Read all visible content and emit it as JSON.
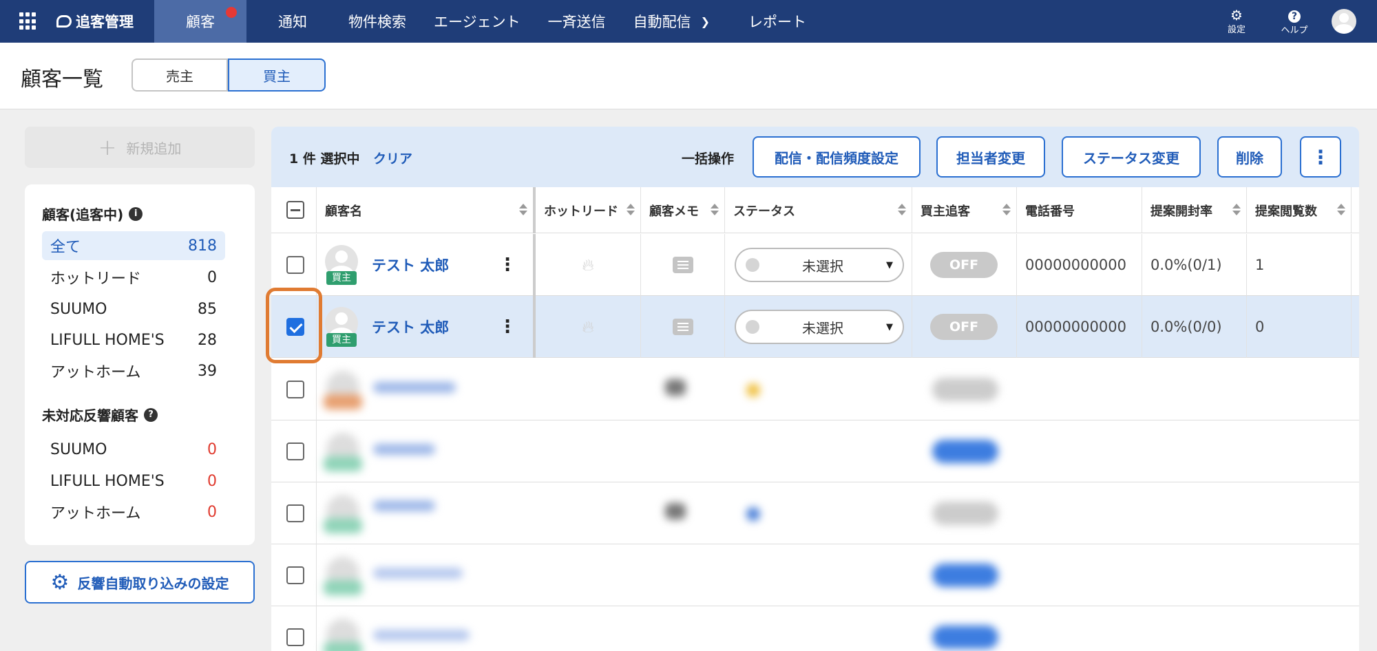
{
  "nav": {
    "brand": "追客管理",
    "items": [
      {
        "label": "顧客",
        "active": true,
        "notify": true
      },
      {
        "label": "通知"
      },
      {
        "label": "物件検索"
      },
      {
        "label": "エージェント"
      },
      {
        "label": "一斉送信"
      },
      {
        "label": "自動配信",
        "dropdown": true
      },
      {
        "label": "レポート"
      }
    ],
    "settings_label": "設定",
    "help_label": "ヘルプ"
  },
  "page": {
    "title": "顧客一覧",
    "tabs": [
      {
        "label": "売主"
      },
      {
        "label": "買主",
        "active": true
      }
    ]
  },
  "sidebar": {
    "new_button": "新規追加",
    "section1_title": "顧客(追客中)",
    "section1_items": [
      {
        "label": "全て",
        "count": "818",
        "selected": true
      },
      {
        "label": "ホットリード",
        "count": "0"
      },
      {
        "label": "SUUMO",
        "count": "85"
      },
      {
        "label": "LIFULL HOME'S",
        "count": "28"
      },
      {
        "label": "アットホーム",
        "count": "39"
      }
    ],
    "section2_title": "未対応反響顧客",
    "section2_items": [
      {
        "label": "SUUMO",
        "count": "0"
      },
      {
        "label": "LIFULL HOME'S",
        "count": "0"
      },
      {
        "label": "アットホーム",
        "count": "0"
      }
    ],
    "settings_button": "反響自動取り込みの設定"
  },
  "bulk": {
    "selected_text": "1 件 選択中",
    "clear": "クリア",
    "label": "一括操作",
    "buttons": [
      "配信・配信頻度設定",
      "担当者変更",
      "ステータス変更",
      "削除"
    ]
  },
  "table": {
    "columns": [
      "顧客名",
      "ホットリード",
      "顧客メモ",
      "ステータス",
      "買主追客",
      "電話番号",
      "提案開封率",
      "提案閲覧数"
    ],
    "rows": [
      {
        "tag": "買主",
        "name": "テスト 太郎",
        "status": "未選択",
        "follow": "OFF",
        "phone": "00000000000",
        "open_rate": "0.0%(0/1)",
        "views": "1",
        "checked": false
      },
      {
        "tag": "買主",
        "name": "テスト 太郎",
        "status": "未選択",
        "follow": "OFF",
        "phone": "00000000000",
        "open_rate": "0.0%(0/0)",
        "views": "0",
        "checked": true
      }
    ]
  },
  "colors": {
    "nav_bg": "#1f3d78",
    "accent": "#2a6fd1",
    "selected_row": "#dde9f8",
    "highlight": "#e07b32",
    "buyer_tag": "#2f9e6e"
  }
}
